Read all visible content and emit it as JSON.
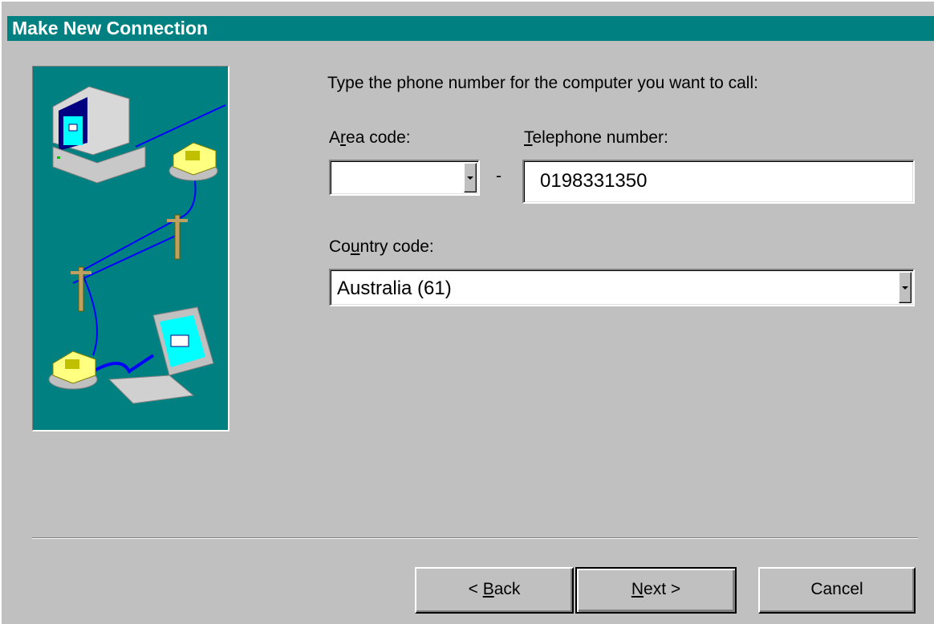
{
  "window": {
    "title": "Make New Connection"
  },
  "instructions": "Type the phone number for the computer you want to call:",
  "area_code": {
    "label_pre": "A",
    "label_mnemonic": "r",
    "label_post": "ea code:",
    "value": ""
  },
  "separator": "-",
  "telephone": {
    "label_pre": "",
    "label_mnemonic": "T",
    "label_post": "elephone number:",
    "value": "0198331350"
  },
  "country_code": {
    "label_pre": "Co",
    "label_mnemonic": "u",
    "label_post": "ntry code:",
    "value": "Australia (61)"
  },
  "buttons": {
    "back_prefix": "< ",
    "back_mnemonic": "B",
    "back_rest": "ack",
    "next_mnemonic": "N",
    "next_rest": "ext >",
    "cancel": "Cancel"
  },
  "colors": {
    "title_bar": "#008080",
    "face": "#c0c0c0",
    "illustration_bg": "#008080"
  },
  "illustration_icons": [
    "desktop-computer-icon",
    "telephone-icon",
    "telephone-pole-icon",
    "laptop-icon"
  ]
}
